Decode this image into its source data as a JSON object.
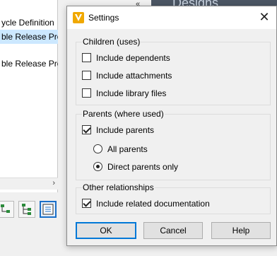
{
  "background": {
    "rows": [
      "ycle Definition",
      "ble Release Proc",
      "ble Release Proc"
    ],
    "chevron": "«",
    "top_right_text": "Designs",
    "scroll_right_arrow": "›"
  },
  "dialog": {
    "title": "Settings",
    "icon": "v-app-icon",
    "close_glyph": "✕",
    "groups": {
      "children": {
        "label": "Children (uses)",
        "options": [
          {
            "label": "Include dependents",
            "checked": false
          },
          {
            "label": "Include attachments",
            "checked": false
          },
          {
            "label": "Include library files",
            "checked": false
          }
        ]
      },
      "parents": {
        "label": "Parents (where used)",
        "include_parents": {
          "label": "Include parents",
          "checked": true
        },
        "radios": [
          {
            "label": "All parents",
            "selected": false
          },
          {
            "label": "Direct parents only",
            "selected": true
          }
        ]
      },
      "other": {
        "label": "Other relationships",
        "include_docs": {
          "label": "Include related documentation",
          "checked": true
        }
      }
    },
    "buttons": {
      "ok": "OK",
      "cancel": "Cancel",
      "help": "Help"
    }
  },
  "colors": {
    "accent": "#0078d7",
    "selection": "#cce8ff",
    "app_icon": "#f0a800"
  }
}
